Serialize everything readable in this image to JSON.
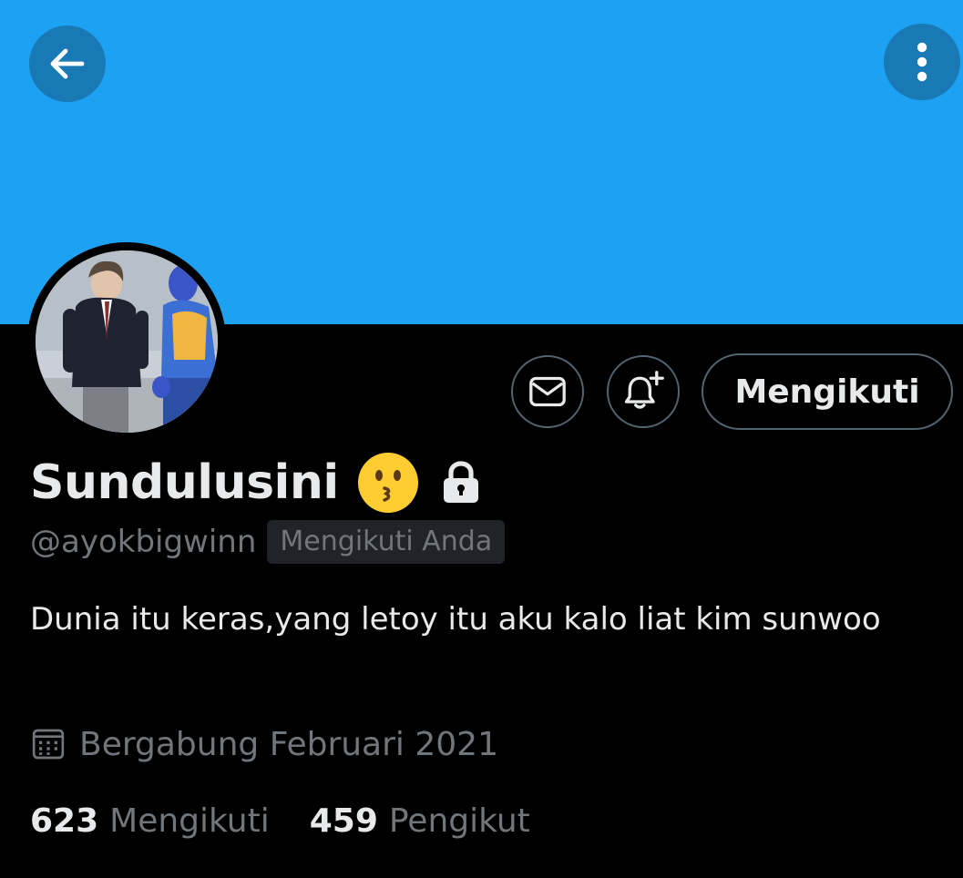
{
  "colors": {
    "banner": "#1DA1F2",
    "background": "#000000",
    "primary_text": "#e7e9ea",
    "secondary_text": "#71767b",
    "button_border": "#536471"
  },
  "header": {
    "back_icon": "arrow-left-icon",
    "more_icon": "more-vertical-icon"
  },
  "profile": {
    "display_name": "Sundulusini",
    "name_emoji": "kissing-face-emoji",
    "protected_icon": "lock-icon",
    "handle": "@ayokbigwinn",
    "follows_you_badge": "Mengikuti Anda",
    "bio": "Dunia itu keras,yang letoy itu aku kalo liat kim sunwoo",
    "joined_icon": "calendar-icon",
    "joined": "Bergabung Februari 2021"
  },
  "actions": {
    "message_icon": "mail-icon",
    "notify_icon": "bell-plus-icon",
    "follow_button": "Mengikuti"
  },
  "stats": {
    "following_count": "623",
    "following_label": "Mengikuti",
    "followers_count": "459",
    "followers_label": "Pengikut"
  }
}
